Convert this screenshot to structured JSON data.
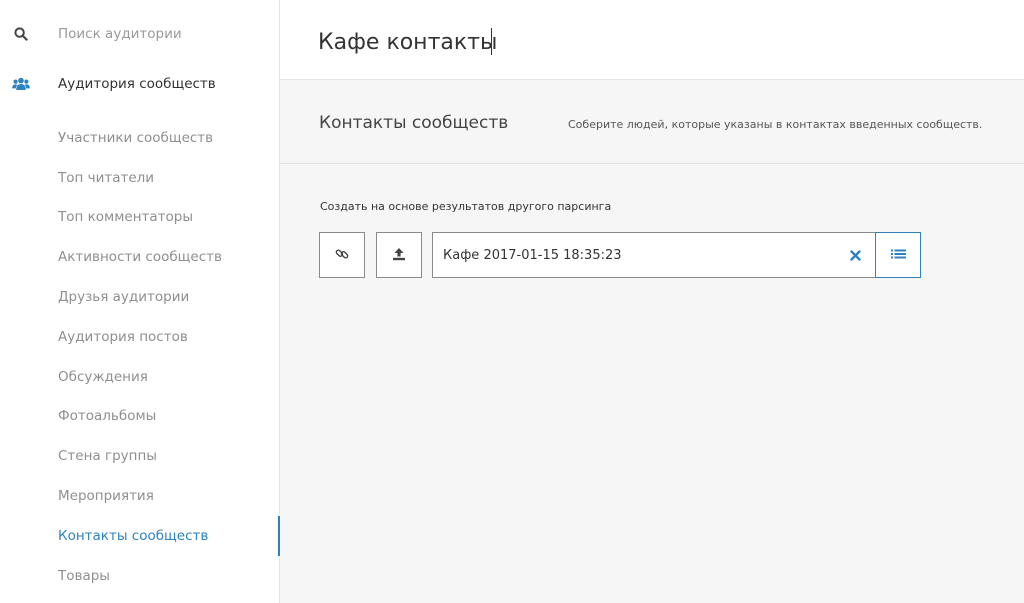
{
  "sidebar": {
    "search": {
      "label": "Поиск аудитории",
      "icon": "search-icon"
    },
    "audience": {
      "label": "Аудитория сообществ",
      "icon": "users-icon"
    },
    "items": [
      {
        "label": "Участники сообществ"
      },
      {
        "label": "Топ читатели"
      },
      {
        "label": "Топ комментаторы"
      },
      {
        "label": "Активности сообществ"
      },
      {
        "label": "Друзья аудитории"
      },
      {
        "label": "Аудитория постов"
      },
      {
        "label": "Обсуждения"
      },
      {
        "label": "Фотоальбомы"
      },
      {
        "label": "Стена группы"
      },
      {
        "label": "Мероприятия"
      },
      {
        "label": "Контакты сообществ",
        "active": true
      },
      {
        "label": "Товары"
      }
    ]
  },
  "header": {
    "title_value": "Кафе контакты"
  },
  "section": {
    "title": "Контакты сообществ",
    "description": "Соберите людей, которые указаны в контактах введенных сообществ."
  },
  "main": {
    "parse_label": "Создать на основе результатов другого парсинга",
    "selected_value": "Кафе  2017-01-15 18:35:23",
    "buttons": {
      "link_icon": "link-icon",
      "upload_icon": "upload-icon",
      "clear_icon": "close-icon",
      "list_icon": "list-icon"
    }
  },
  "colors": {
    "accent": "#2f82c0",
    "sidebar_bg": "#ffffff",
    "page_bg": "#f6f6f6"
  }
}
